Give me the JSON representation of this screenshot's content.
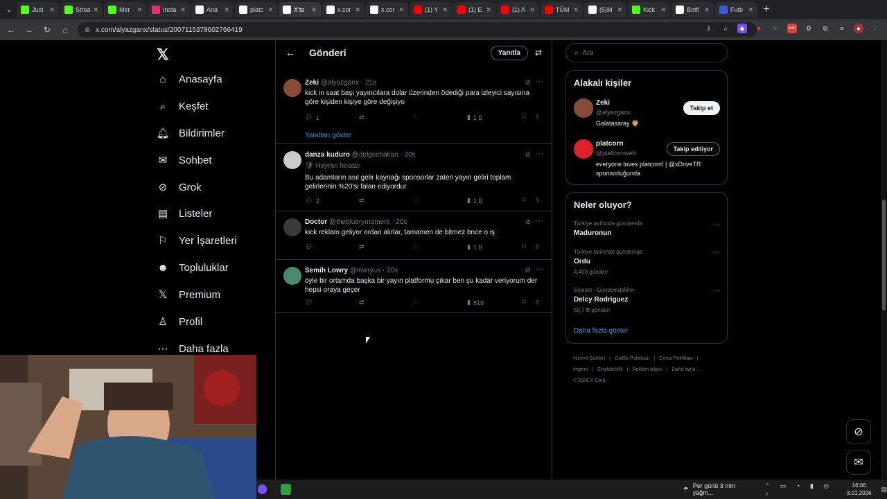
{
  "browser": {
    "tabs": [
      {
        "label": "Just",
        "icon": "kick-icon",
        "color": "#53fc18"
      },
      {
        "label": "Strea",
        "icon": "kick-icon",
        "color": "#53fc18"
      },
      {
        "label": "Mer",
        "icon": "kick-icon",
        "color": "#53fc18"
      },
      {
        "label": "Insta",
        "icon": "instagram-icon",
        "color": "#e1306c"
      },
      {
        "label": "Ana",
        "icon": "x-icon",
        "color": "#ffffff"
      },
      {
        "label": "platc",
        "icon": "x-icon",
        "color": "#ffffff"
      },
      {
        "label": "X'te",
        "icon": "x-icon",
        "color": "#ffffff"
      },
      {
        "label": "x.cor",
        "icon": "x-icon",
        "color": "#ffffff"
      },
      {
        "label": "x.cor",
        "icon": "x-icon",
        "color": "#ffffff"
      },
      {
        "label": "(1) Y",
        "icon": "youtube-icon",
        "color": "#ff0000"
      },
      {
        "label": "(1) E",
        "icon": "youtube-icon",
        "color": "#ff0000"
      },
      {
        "label": "(1) A",
        "icon": "youtube-icon",
        "color": "#ff0000"
      },
      {
        "label": "TÜM",
        "icon": "youtube-icon",
        "color": "#ff0000"
      },
      {
        "label": "(5)M",
        "icon": "tiktok-icon",
        "color": "#ffffff"
      },
      {
        "label": "Kick",
        "icon": "kick-icon",
        "color": "#53fc18"
      },
      {
        "label": "Botfl",
        "icon": "bot-icon",
        "color": "#ffffff"
      },
      {
        "label": "Futb",
        "icon": "football-icon",
        "color": "#3b5bdb"
      }
    ],
    "url": "x.com/alyazganx/status/2007115378602766419"
  },
  "nav": {
    "items": [
      {
        "label": "Anasayfa",
        "icon": "home-icon",
        "glyph": "⌂"
      },
      {
        "label": "Keşfet",
        "icon": "search-icon",
        "glyph": "⌕"
      },
      {
        "label": "Bildirimler",
        "icon": "bell-icon",
        "glyph": "🔔︎"
      },
      {
        "label": "Sohbet",
        "icon": "mail-icon",
        "glyph": "✉"
      },
      {
        "label": "Grok",
        "icon": "grok-icon",
        "glyph": "⊘"
      },
      {
        "label": "Listeler",
        "icon": "list-icon",
        "glyph": "▤"
      },
      {
        "label": "Yer İşaretleri",
        "icon": "bookmark-icon",
        "glyph": "⚐"
      },
      {
        "label": "Topluluklar",
        "icon": "communities-icon",
        "glyph": "☻"
      },
      {
        "label": "Premium",
        "icon": "x-premium-icon",
        "glyph": "𝕏"
      },
      {
        "label": "Profil",
        "icon": "profile-icon",
        "glyph": "♙"
      },
      {
        "label": "Daha fazla",
        "icon": "more-circle-icon",
        "glyph": "⋯"
      }
    ]
  },
  "header": {
    "title": "Gönderi",
    "reply_label": "Yanıtla"
  },
  "tweets": [
    {
      "name": "Zeki",
      "handle": "@alyazganx",
      "time": "21s",
      "badge": "",
      "text": "kick in saat başı yayıncılara dolar üzerinden ödediği para  izleyici sayısına göre kişiden kişiye göre değişiyo",
      "replies": "1",
      "views": "1 B",
      "show_replies": "Yanıtları göster",
      "avatar_color": "#8a4a3a"
    },
    {
      "name": "danza kuduro",
      "handle": "@delgechakan",
      "time": "20s",
      "badge": "🛡 Hayran hesabı",
      "text": "Bu adamların asıl gelir kaynağı sponsorlar zaten yayın geliri toplam gelirlerinin %20'si falan ediyordur",
      "replies": "2",
      "views": "1 B",
      "avatar_color": "#cccccc"
    },
    {
      "name": "Doctor",
      "handle": "@thebluerymoment",
      "time": "20s",
      "badge": "",
      "text": "kick reklam geliyor ordan alırlar, tamamen de bitmez bnce o iş",
      "replies": "",
      "views": "1 B",
      "avatar_color": "#3a3a3a"
    },
    {
      "name": "Semih Lowry",
      "handle": "@lowryus",
      "time": "20s",
      "badge": "",
      "text": "öyle bir ortamda başka bir yayın platformu çıkar ben şu kadar veriyorum der hepsi oraya geçer",
      "replies": "",
      "views": "819",
      "avatar_color": "#4a8a6a"
    }
  ],
  "search": {
    "placeholder": "Ara"
  },
  "related": {
    "title": "Alakalı kişiler",
    "people": [
      {
        "name": "Zeki",
        "handle": "@alyazganx",
        "bio": "Galatasaray 🦁",
        "button": "Takip et",
        "avatar_color": "#8a4a3a"
      },
      {
        "name": "platcorn",
        "handle": "@platcornweb",
        "bio": "everyone loves platcorn! | @xDriveTR sponsorluğunda",
        "button": "Takip ediliyor",
        "avatar_color": "#e0202a"
      }
    ]
  },
  "trends": {
    "title": "Neler oluyor?",
    "items": [
      {
        "meta": "Türkiye tarihinde gündemde",
        "name": "Maduronun",
        "count": ""
      },
      {
        "meta": "Türkiye tarihinde gündemde",
        "name": "Ordu",
        "count": "4,403 gönderi"
      },
      {
        "meta": "Siyaset · Gündemdekiler",
        "name": "Delcy Rodriguez",
        "count": "50,7 B gönderi"
      }
    ],
    "show_more": "Daha fazla göster"
  },
  "footer": {
    "line1": [
      "Hizmet Şartları",
      "|",
      "Gizlilik Politikası",
      "|",
      "Çerez Politikası",
      "|"
    ],
    "line2": [
      "Imprint",
      "|",
      "Erişilebilirlik",
      "|",
      "Reklam bilgisi",
      "|",
      "Daha fazla ..."
    ],
    "copyright": "© 2026 X Corp."
  },
  "taskbar": {
    "weather": "Per günü 3 mm yağm...",
    "time": "16:06",
    "date": "3.01.2026"
  },
  "colors": {
    "accent": "#1d9bf0",
    "background": "#000000",
    "border": "#2f3336"
  }
}
